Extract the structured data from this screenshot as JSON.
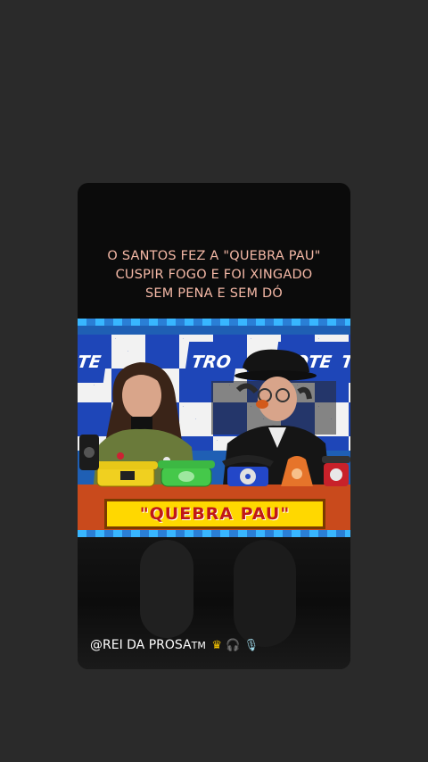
{
  "caption": {
    "line1": "O SANTOS FEZ A \"QUEBRA PAU\"",
    "line2": "CUSPIR FOGO E FOI XINGADO",
    "line3": "SEM PENA E SEM DÓ"
  },
  "video": {
    "signs": [
      "TE",
      "TRO",
      "ROTE",
      "T"
    ],
    "banner_text": "\"QUEBRA PAU\""
  },
  "watermark": {
    "handle": "@REI DA PROSA",
    "tm": "TM",
    "icons": [
      "crown-icon",
      "headphones-icon",
      "microphone-icon"
    ]
  },
  "colors": {
    "background": "#2a2a2a",
    "caption": "#f4b8a6",
    "banner_fill": "#ffd800",
    "banner_text": "#c01818",
    "set_blue": "#1e46b8"
  }
}
